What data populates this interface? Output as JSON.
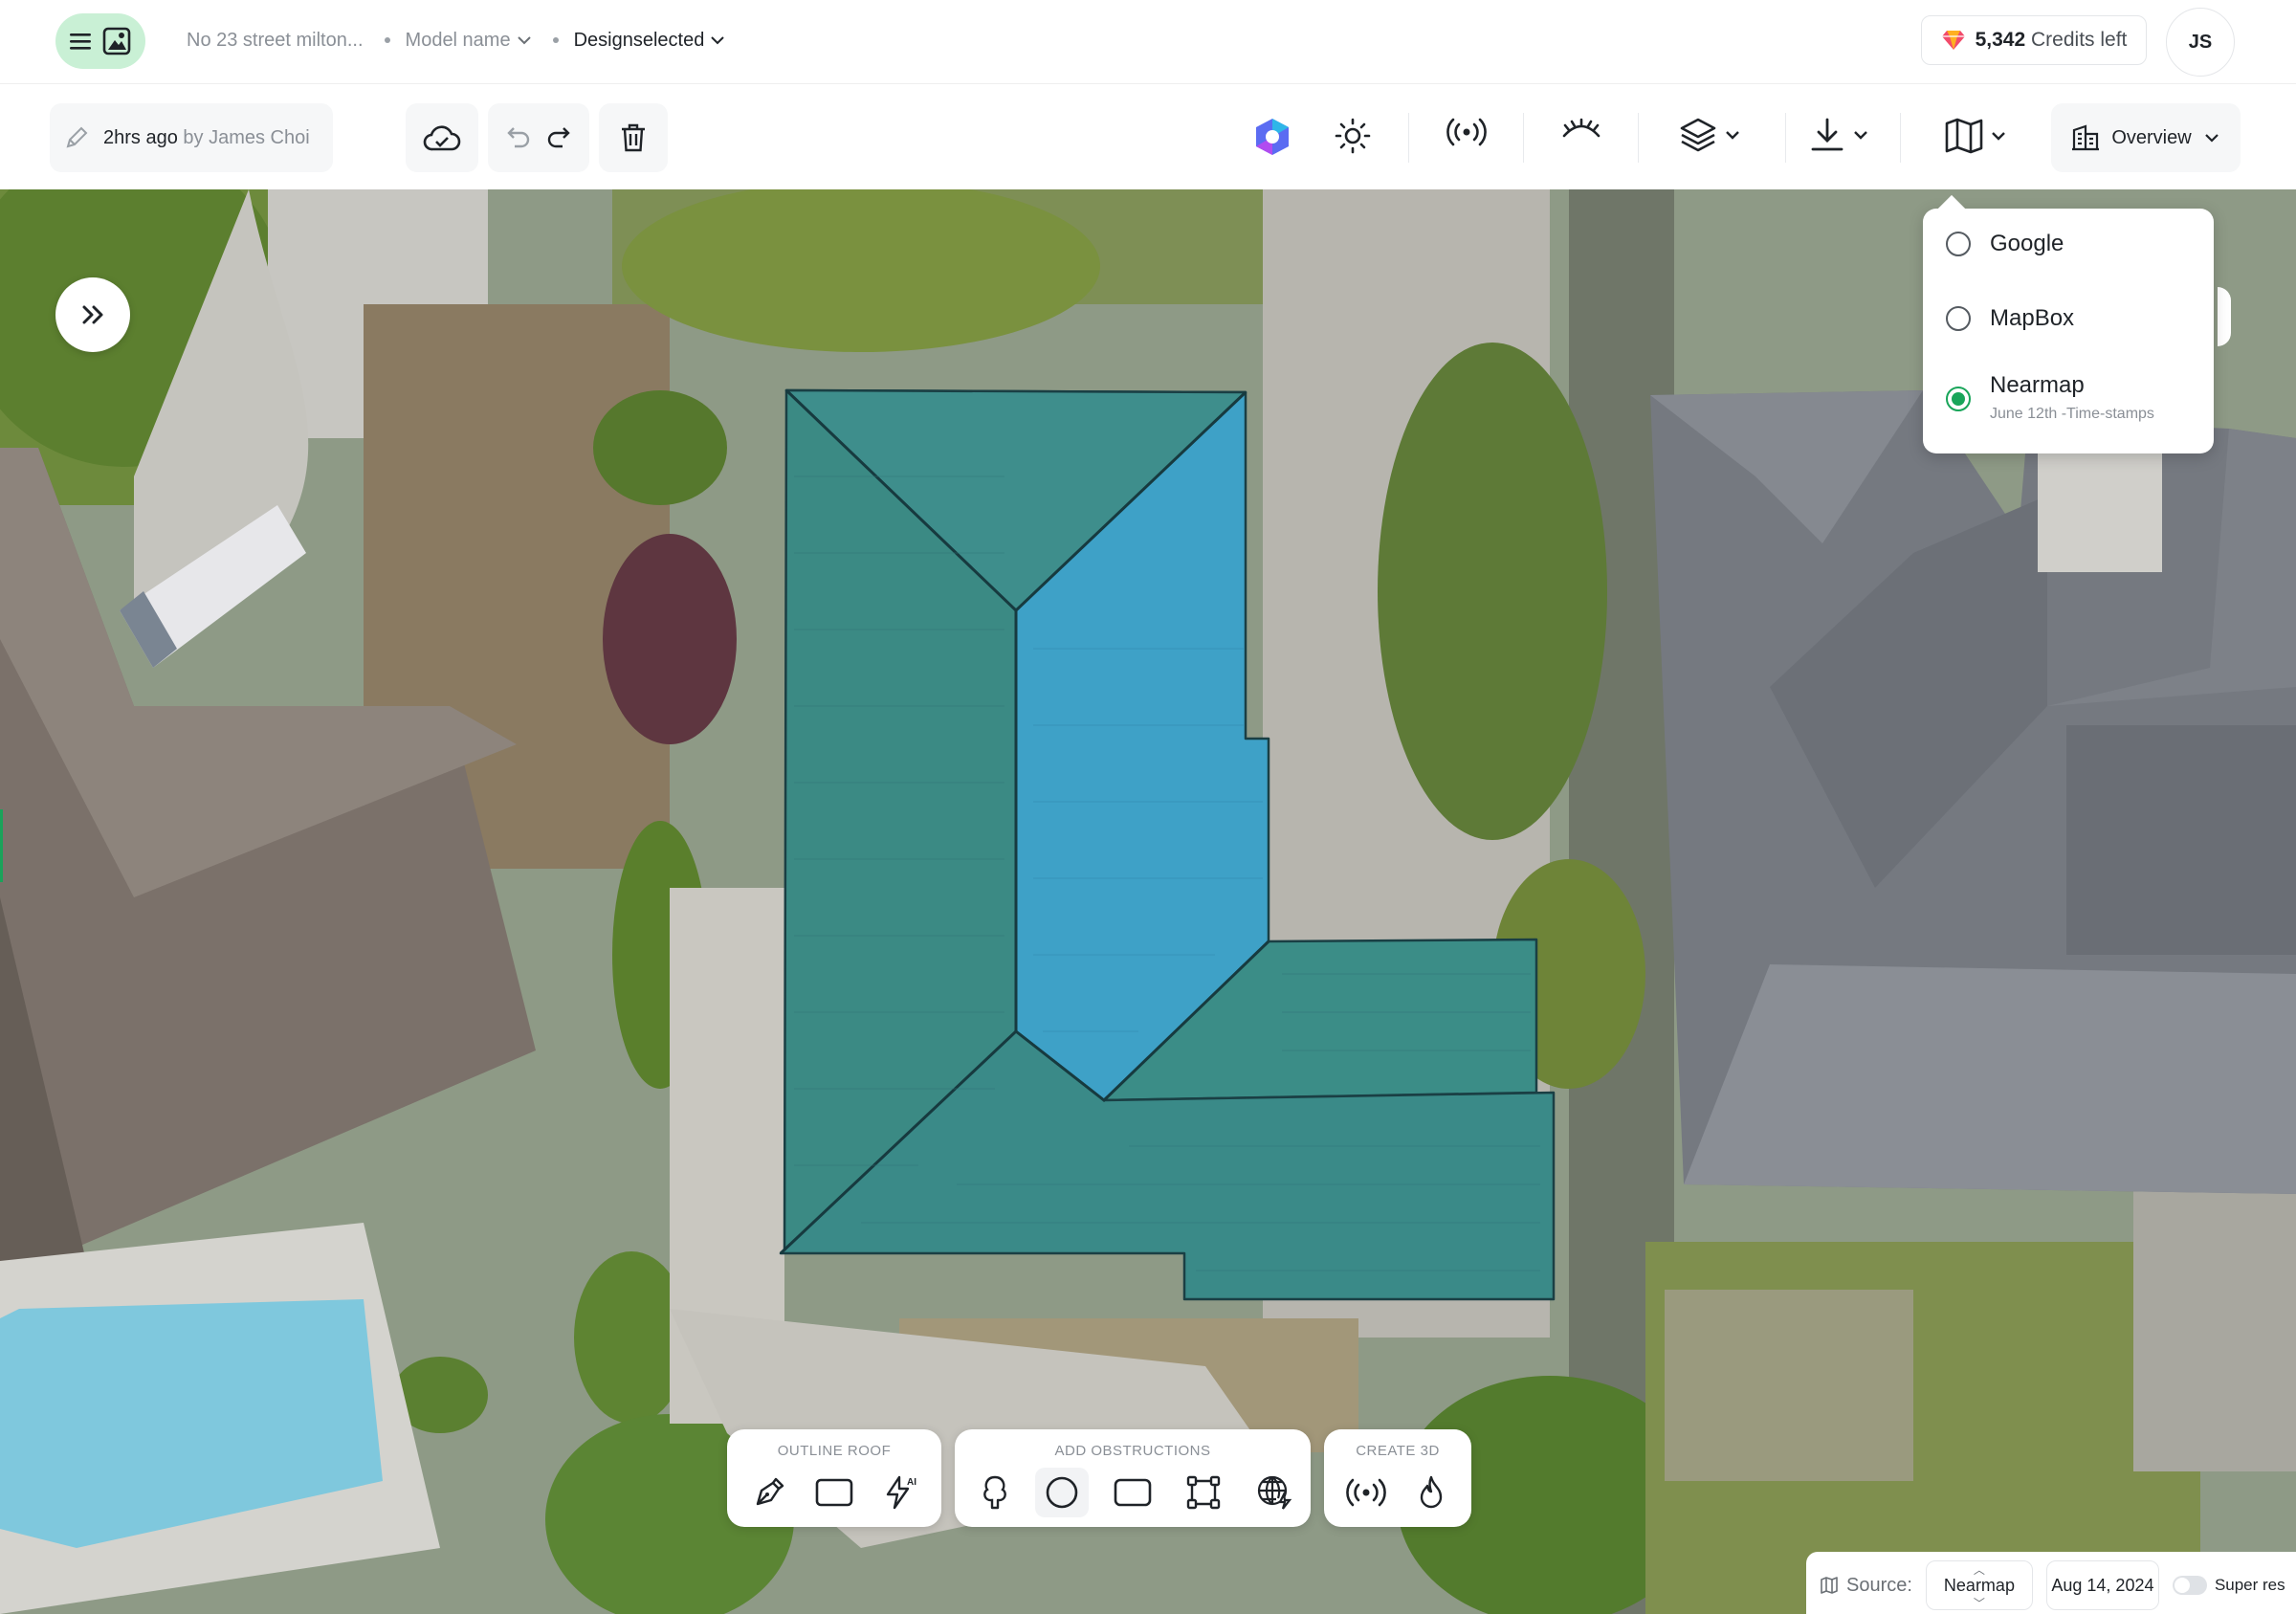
{
  "header": {
    "address": "No 23 street milton...",
    "model_name": "Model name",
    "design": "Designselected",
    "credits_value": "5,342",
    "credits_suffix": "Credits left",
    "user_initials": "JS"
  },
  "toolbar": {
    "edited_time": "2hrs ago",
    "edited_by": "by James Choi",
    "view_mode": "Overview"
  },
  "imagery_dropdown": {
    "options": [
      {
        "label": "Google",
        "selected": false
      },
      {
        "label": "MapBox",
        "selected": false
      },
      {
        "label": "Nearmap",
        "selected": true,
        "sub": "June 12th  -Time-stamps"
      }
    ]
  },
  "tool_groups": {
    "outline_roof": {
      "title": "OUTLINE ROOF",
      "tools": [
        "pen-icon",
        "rectangle-icon",
        "ai-bolt-icon"
      ]
    },
    "add_obstructions": {
      "title": "ADD OBSTRUCTIONS",
      "tools": [
        "tree-icon",
        "circle-icon",
        "rounded-rect-icon",
        "polygon-icon",
        "grid-globe-icon"
      ]
    },
    "create_3d": {
      "title": "CREATE 3D",
      "tools": [
        "signal-icon",
        "flame-icon"
      ]
    }
  },
  "source_bar": {
    "label": "Source:",
    "source_value": "Nearmap",
    "date": "Aug 14, 2024",
    "super_res_label": "Super res"
  },
  "colors": {
    "accent_green": "#19a55a",
    "logo_bg": "#c9f0d5",
    "roof_teal": "#2f8a8e",
    "roof_blue": "#3a9dc4"
  }
}
